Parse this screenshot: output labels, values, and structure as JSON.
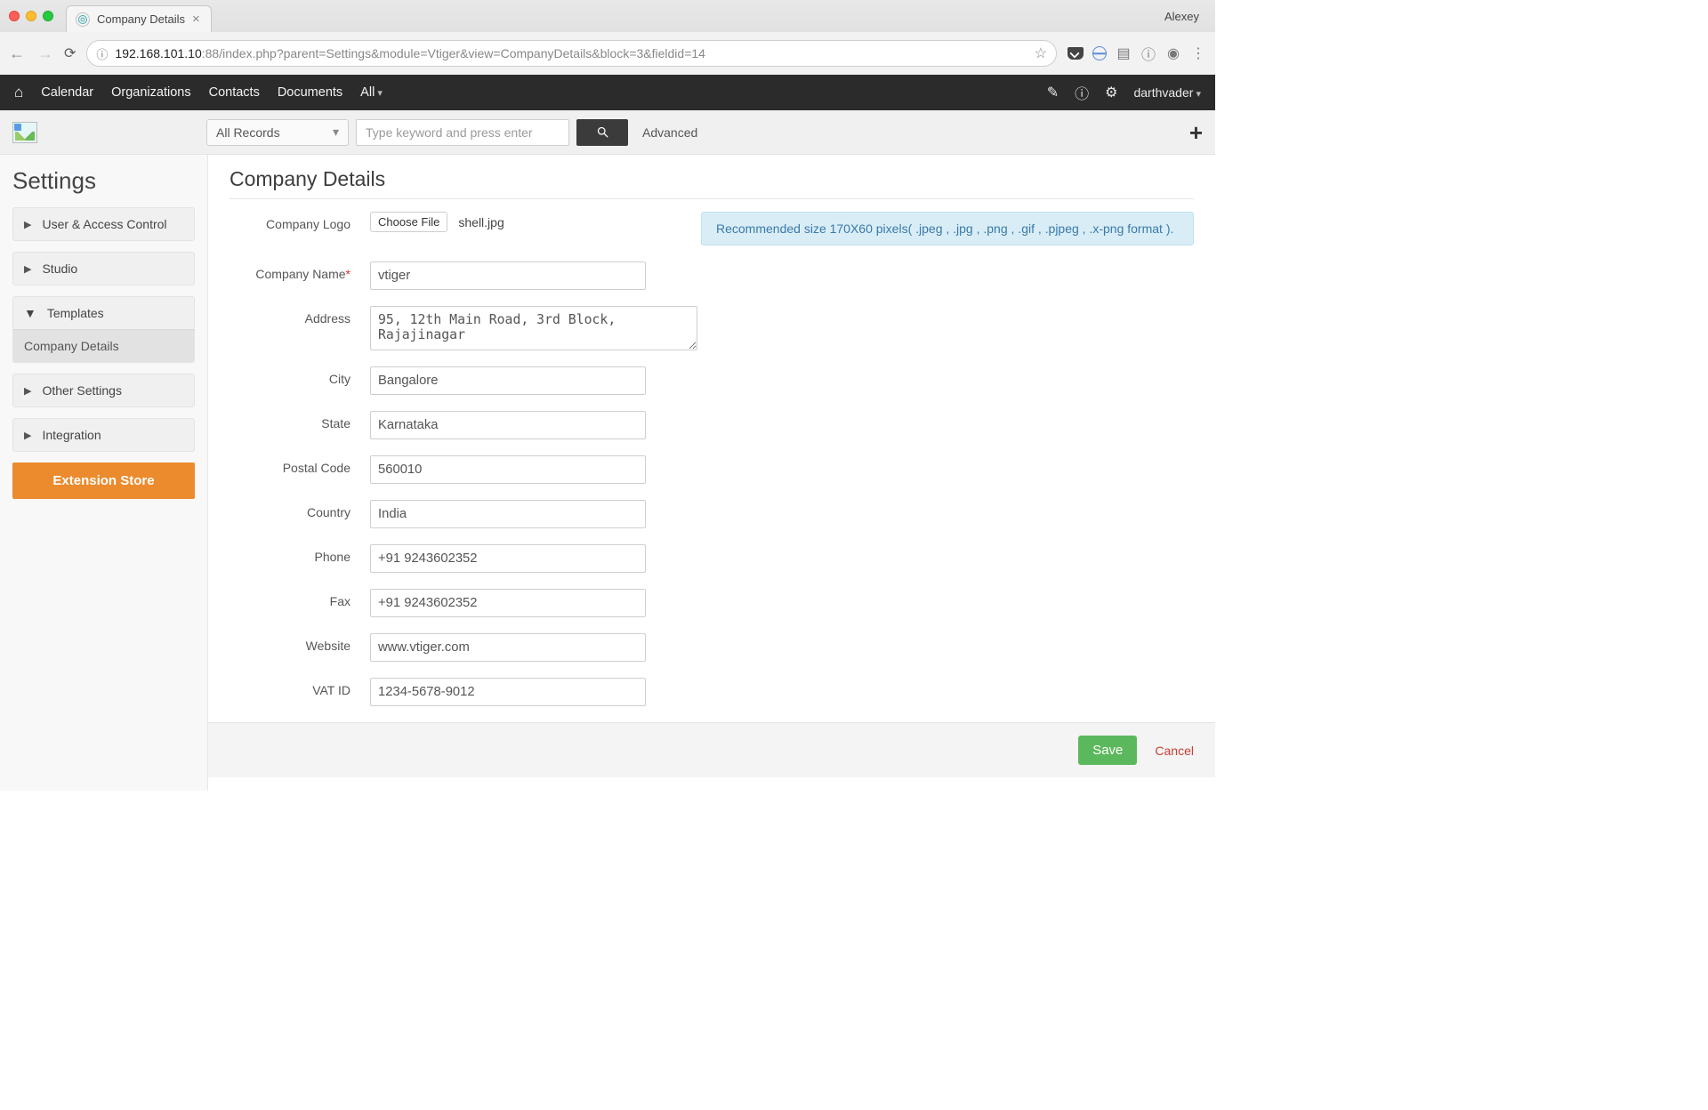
{
  "browser": {
    "tab_title": "Company Details",
    "user": "Alexey",
    "url_host": "192.168.101.10",
    "url_path": ":88/index.php?parent=Settings&module=Vtiger&view=CompanyDetails&block=3&fieldid=14"
  },
  "nav": {
    "items": [
      "Calendar",
      "Organizations",
      "Contacts",
      "Documents",
      "All"
    ],
    "user": "darthvader"
  },
  "searchbar": {
    "scope": "All Records",
    "placeholder": "Type keyword and press enter",
    "advanced": "Advanced"
  },
  "sidebar": {
    "title": "Settings",
    "items": [
      {
        "label": "User & Access Control"
      },
      {
        "label": "Studio"
      },
      {
        "label": "Templates",
        "expanded": true,
        "children": [
          "Company Details"
        ]
      },
      {
        "label": "Other Settings"
      },
      {
        "label": "Integration"
      }
    ],
    "extension_store": "Extension Store"
  },
  "page": {
    "title": "Company Details",
    "logo": {
      "label": "Company Logo",
      "choose_file": "Choose File",
      "filename": "shell.jpg",
      "hint": "Recommended size 170X60 pixels( .jpeg , .jpg , .png , .gif , .pjpeg , .x-png format )."
    },
    "fields": {
      "company_name": {
        "label": "Company Name",
        "required": true,
        "value": "vtiger"
      },
      "address": {
        "label": "Address",
        "value": "95, 12th Main Road, 3rd Block, Rajajinagar"
      },
      "city": {
        "label": "City",
        "value": "Bangalore"
      },
      "state": {
        "label": "State",
        "value": "Karnataka"
      },
      "postal_code": {
        "label": "Postal Code",
        "value": "560010"
      },
      "country": {
        "label": "Country",
        "value": "India"
      },
      "phone": {
        "label": "Phone",
        "value": "+91 9243602352"
      },
      "fax": {
        "label": "Fax",
        "value": "+91 9243602352"
      },
      "website": {
        "label": "Website",
        "value": "www.vtiger.com"
      },
      "vat_id": {
        "label": "VAT ID",
        "value": "1234-5678-9012"
      }
    },
    "actions": {
      "save": "Save",
      "cancel": "Cancel"
    }
  }
}
